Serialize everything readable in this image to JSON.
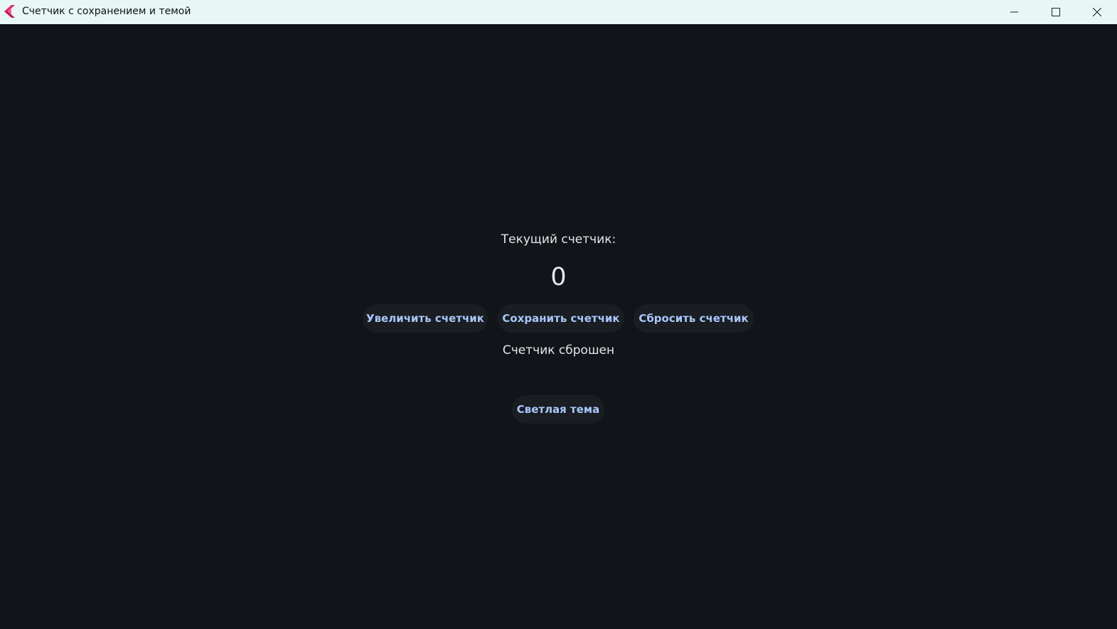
{
  "window": {
    "title": "Счетчик с сохранением и темой",
    "app_icon": "flutter-icon",
    "controls": {
      "minimize_icon": "minimize-icon",
      "maximize_icon": "maximize-icon",
      "close_icon": "close-icon"
    }
  },
  "counter": {
    "label": "Текущий счетчик:",
    "value": "0"
  },
  "buttons": {
    "increment": "Увеличить счетчик",
    "save": "Сохранить счетчик",
    "reset": "Сбросить счетчик"
  },
  "status": {
    "message": "Счетчик сброшен"
  },
  "theme": {
    "toggle_label": "Светлая тема"
  },
  "colors": {
    "background": "#111418",
    "titlebar": "#e6f7f4",
    "button_bg": "#1a1d22",
    "button_text": "#a8c7fa",
    "text": "#e4e6ea"
  }
}
